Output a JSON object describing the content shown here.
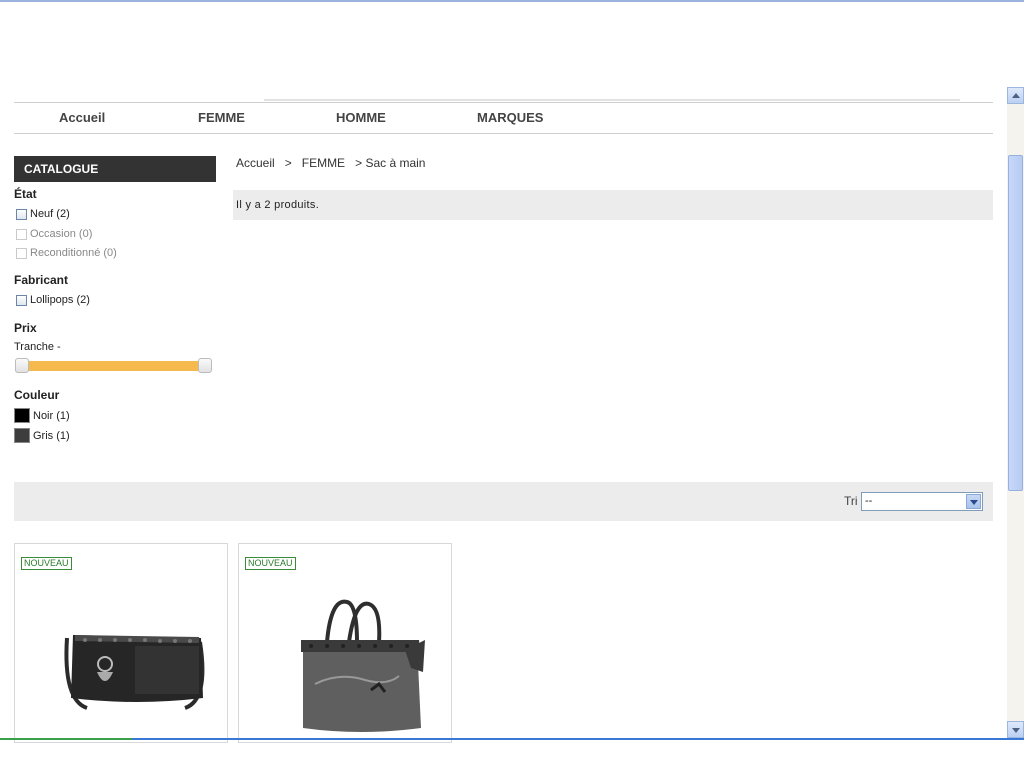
{
  "nav": {
    "items": [
      "Accueil",
      "FEMME",
      "HOMME",
      "MARQUES"
    ]
  },
  "sidebar": {
    "catalogue_title": "CATALOGUE",
    "etat": {
      "title": "État",
      "options": [
        {
          "label": "Neuf (2)",
          "enabled": true
        },
        {
          "label": "Occasion (0)",
          "enabled": false
        },
        {
          "label": "Reconditionné (0)",
          "enabled": false
        }
      ]
    },
    "fabricant": {
      "title": "Fabricant",
      "options": [
        {
          "label": "Lollipops (2)"
        }
      ]
    },
    "prix": {
      "title": "Prix",
      "tranche_label": "Tranche -",
      "slider_color": "#f5b94e"
    },
    "couleur": {
      "title": "Couleur",
      "options": [
        {
          "label": "Noir (1)",
          "color": "#000000"
        },
        {
          "label": "Gris (1)",
          "color": "#3d3d3d"
        }
      ]
    }
  },
  "breadcrumb": {
    "home": "Accueil",
    "sep1": ">",
    "category": "FEMME",
    "sep2": ">",
    "current": "Sac à main"
  },
  "listing": {
    "count_text": "Il y a  2  produits.",
    "sort_label": "Tri",
    "sort_value": "--"
  },
  "products": [
    {
      "badge": "NOUVEAU",
      "image": "black-handbag-icon"
    },
    {
      "badge": "NOUVEAU",
      "image": "grey-tote-bag-icon"
    }
  ]
}
